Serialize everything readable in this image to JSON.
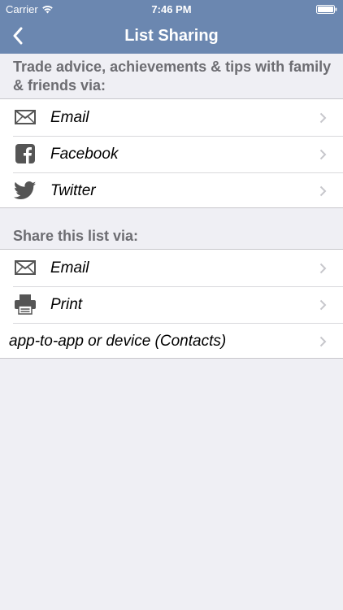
{
  "status_bar": {
    "carrier": "Carrier",
    "time": "7:46 PM"
  },
  "nav": {
    "title": "List Sharing",
    "back_icon": "chevron-left-icon"
  },
  "sections": [
    {
      "header": "Trade advice, achievements & tips with family & friends via:",
      "items": [
        {
          "label": "Email",
          "icon": "envelope-icon"
        },
        {
          "label": "Facebook",
          "icon": "facebook-icon"
        },
        {
          "label": "Twitter",
          "icon": "twitter-bird-icon"
        }
      ]
    },
    {
      "header": "Share this list via:",
      "items": [
        {
          "label": "Email",
          "icon": "envelope-icon"
        },
        {
          "label": "Print",
          "icon": "printer-icon"
        },
        {
          "label": "app-to-app or device (Contacts)",
          "icon": ""
        }
      ]
    }
  ],
  "colors": {
    "nav_background": "#6b87b0",
    "page_background": "#efeff4",
    "section_header_text": "#6d6d72",
    "icon_gray": "#555555",
    "chevron": "#c7c7cc"
  }
}
